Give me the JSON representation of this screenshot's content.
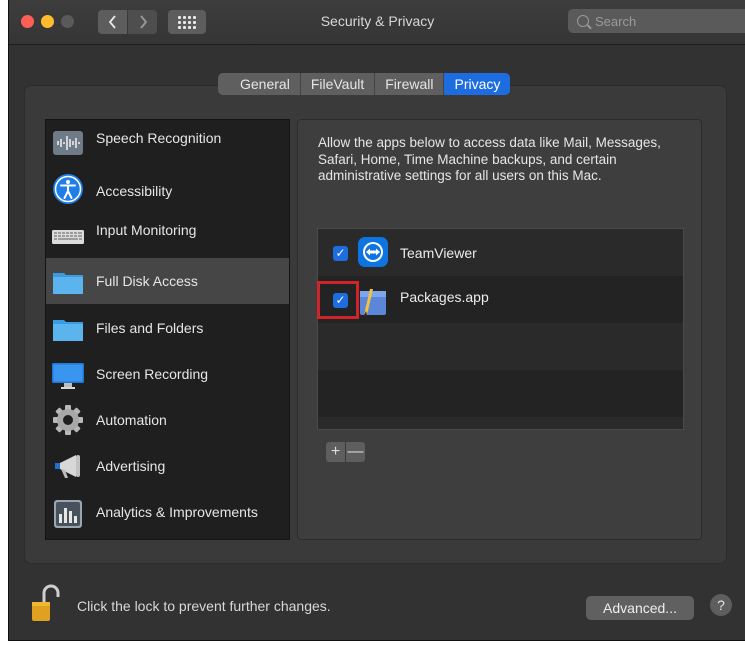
{
  "window": {
    "title": "Security & Privacy"
  },
  "toolbar": {
    "back_icon": "chevron-left-icon",
    "forward_icon": "chevron-right-icon",
    "grid_icon": "show-all-grid-icon",
    "search_placeholder": "Search"
  },
  "tabs": [
    {
      "label": "General",
      "active": false
    },
    {
      "label": "FileVault",
      "active": false
    },
    {
      "label": "Firewall",
      "active": false
    },
    {
      "label": "Privacy",
      "active": true
    }
  ],
  "sidebar": {
    "items": [
      {
        "label": "Speech Recognition",
        "icon": "waveform-icon",
        "selected": false
      },
      {
        "label": "Accessibility",
        "icon": "accessibility-icon",
        "selected": false
      },
      {
        "label": "Input Monitoring",
        "icon": "keyboard-icon",
        "selected": false
      },
      {
        "label": "Full Disk Access",
        "icon": "folder-icon",
        "selected": true
      },
      {
        "label": "Files and Folders",
        "icon": "folder-icon",
        "selected": false
      },
      {
        "label": "Screen Recording",
        "icon": "display-icon",
        "selected": false
      },
      {
        "label": "Automation",
        "icon": "gear-icon",
        "selected": false
      },
      {
        "label": "Advertising",
        "icon": "megaphone-icon",
        "selected": false
      },
      {
        "label": "Analytics & Improvements",
        "icon": "chart-icon",
        "selected": false
      }
    ]
  },
  "detail": {
    "description": "Allow the apps below to access data like Mail, Messages, Safari, Home, Time Machine backups, and certain administrative settings for all users on this Mac.",
    "apps": [
      {
        "name": "TeamViewer",
        "checked": true,
        "icon": "teamviewer-icon"
      },
      {
        "name": "Packages.app",
        "checked": true,
        "icon": "packages-app-icon"
      }
    ],
    "add_label": "+",
    "remove_label": "—"
  },
  "footer": {
    "lock_text": "Click the lock to prevent further changes.",
    "advanced_label": "Advanced...",
    "help_label": "?"
  },
  "colors": {
    "accent": "#1d6de0",
    "highlight_box": "#d0242b",
    "window_bg": "#323232"
  }
}
